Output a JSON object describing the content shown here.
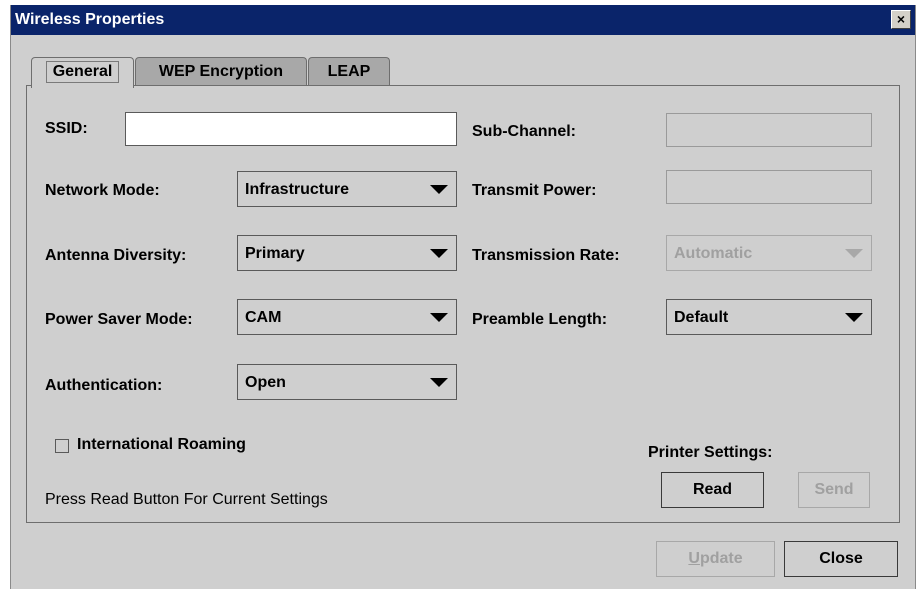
{
  "window": {
    "title": "Wireless Properties",
    "close_glyph": "×"
  },
  "tabs": [
    {
      "label": "General",
      "active": true
    },
    {
      "label": "WEP Encryption",
      "active": false
    },
    {
      "label": "LEAP",
      "active": false
    }
  ],
  "general": {
    "ssid": {
      "label": "SSID:",
      "value": ""
    },
    "network_mode": {
      "label": "Network Mode:",
      "value": "Infrastructure"
    },
    "antenna_diversity": {
      "label": "Antenna Diversity:",
      "value": "Primary"
    },
    "power_saver_mode": {
      "label": "Power Saver Mode:",
      "value": "CAM"
    },
    "authentication": {
      "label": "Authentication:",
      "value": "Open"
    },
    "sub_channel": {
      "label": "Sub-Channel:",
      "value": "",
      "enabled": false
    },
    "transmit_power": {
      "label": "Transmit Power:",
      "value": "",
      "enabled": false
    },
    "transmission_rate": {
      "label": "Transmission Rate:",
      "value": "Automatic",
      "enabled": false
    },
    "preamble_length": {
      "label": "Preamble Length:",
      "value": "Default"
    },
    "international_roaming": {
      "label": "International Roaming",
      "checked": false
    },
    "hint": "Press Read Button For Current Settings",
    "printer_settings_label": "Printer Settings:",
    "read_button": "Read",
    "send_button": {
      "label": "Send",
      "enabled": false
    }
  },
  "footer": {
    "update_button": {
      "mnemonic": "U",
      "rest": "pdate",
      "enabled": false
    },
    "close_button": "Close"
  },
  "colors": {
    "titlebar": "#0a246a",
    "dialog_bg": "#cfcfcf",
    "inactive_tab": "#a8a8a8",
    "disabled_text": "#a0a0a0"
  }
}
